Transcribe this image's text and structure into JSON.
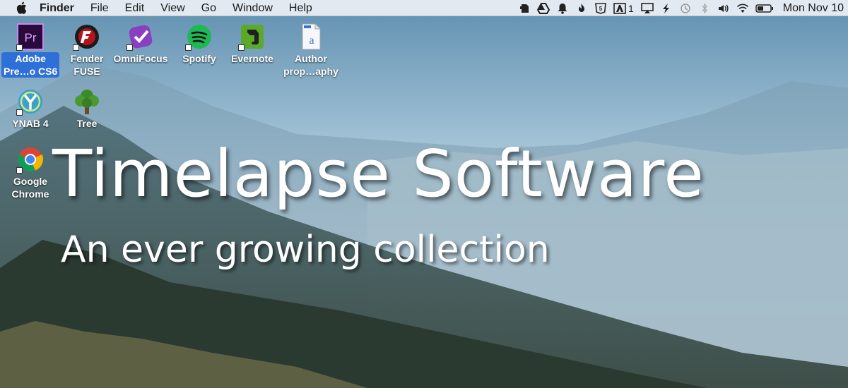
{
  "menubar": {
    "apple_icon": "apple-icon",
    "items": [
      "Finder",
      "File",
      "Edit",
      "View",
      "Go",
      "Window",
      "Help"
    ],
    "status_icons": [
      "evernote-icon",
      "google-drive-icon",
      "notification-bell-icon",
      "flame-icon",
      "html5-icon",
      "adobe-icon",
      "airplay-icon",
      "bolt-icon",
      "time-machine-icon",
      "bluetooth-icon",
      "volume-icon",
      "wifi-icon",
      "battery-icon"
    ],
    "adobe_count": "1",
    "clock": "Mon Nov 10"
  },
  "desktop_icons": [
    {
      "label": "Adobe\nPre…o CS6",
      "icon": "adobe-premiere-icon",
      "selected": true
    },
    {
      "label": "Fender\nFUSE",
      "icon": "fender-fuse-icon",
      "selected": false
    },
    {
      "label": "OmniFocus",
      "icon": "omnifocus-icon",
      "selected": false
    },
    {
      "label": "Spotify",
      "icon": "spotify-icon",
      "selected": false
    },
    {
      "label": "Evernote",
      "icon": "evernote-icon",
      "selected": false
    },
    {
      "label": "Author\nprop…aphy",
      "icon": "document-icon",
      "selected": false
    },
    {
      "label": "YNAB 4",
      "icon": "ynab-icon",
      "selected": false
    },
    {
      "label": "Tree",
      "icon": "tree-icon",
      "selected": false
    },
    {
      "label": "Google\nChrome",
      "icon": "chrome-icon",
      "selected": false
    }
  ],
  "overlay": {
    "title": "Timelapse Software",
    "subtitle": "An ever growing collection"
  },
  "colors": {
    "selection": "#2e6fd8",
    "premiere": "#2a0a3d",
    "premiere_text": "#e1a0ff",
    "spotify": "#1db954",
    "evernote": "#5aa92a",
    "omnifocus": "#8a3fc1"
  }
}
